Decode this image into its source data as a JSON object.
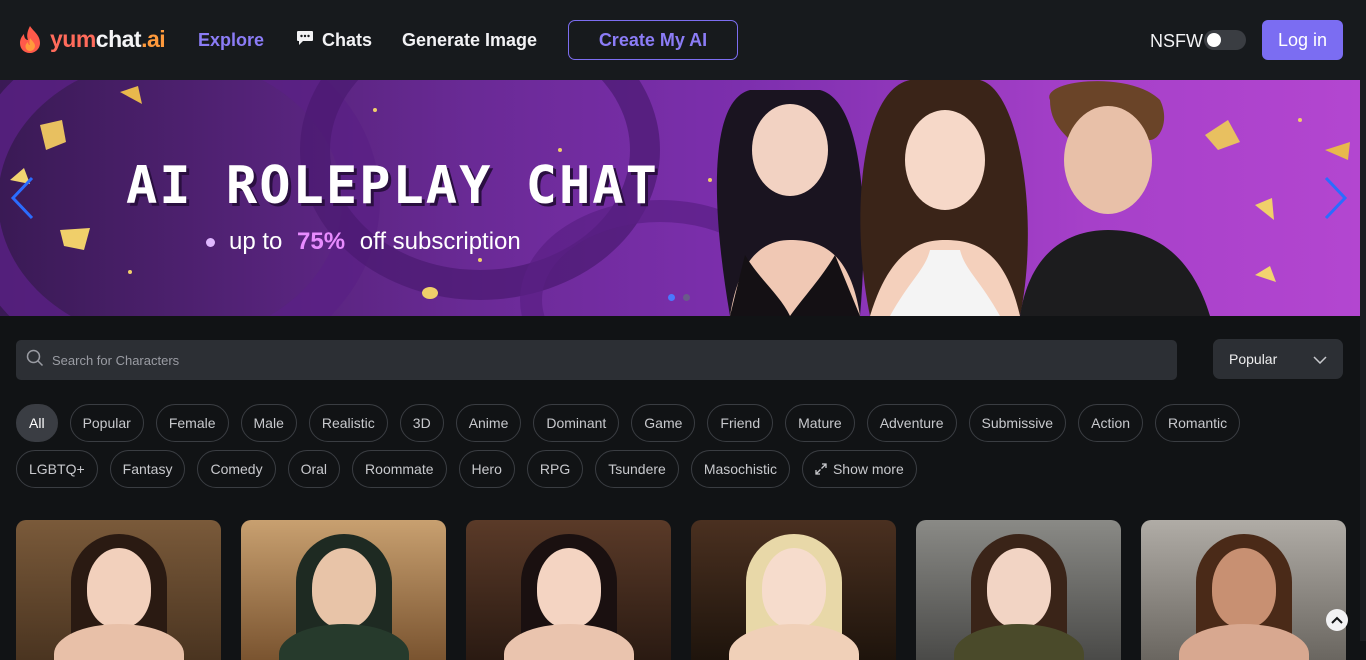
{
  "header": {
    "logo": {
      "part1": "yum",
      "part2": "chat",
      "part3": ".ai"
    },
    "nav": {
      "explore": "Explore",
      "chats": "Chats",
      "generate_image": "Generate Image"
    },
    "create_button": "Create My AI",
    "nsfw_label": "NSFW",
    "nsfw_enabled": false,
    "login_button": "Log in"
  },
  "banner": {
    "title": "AI ROLEPLAY CHAT",
    "subtitle_prefix": "up to ",
    "subtitle_highlight": "75%",
    "subtitle_suffix": " off subscription",
    "slide_count": 2,
    "active_slide": 1
  },
  "search": {
    "placeholder": "Search for Characters"
  },
  "sort": {
    "selected": "Popular"
  },
  "tags": {
    "row1": [
      "All",
      "Popular",
      "Female",
      "Male",
      "Realistic",
      "3D",
      "Anime",
      "Dominant",
      "Game",
      "Friend",
      "Mature",
      "Adventure",
      "Submissive",
      "Action",
      "Romantic"
    ],
    "row2": [
      "LGBTQ+",
      "Fantasy",
      "Comedy",
      "Oral",
      "Roommate",
      "Hero",
      "RPG",
      "Tsundere",
      "Masochistic"
    ],
    "active": "All",
    "show_more": "Show more"
  },
  "colors": {
    "accent": "#7b6df2",
    "page_bg": "#111315",
    "header_bg": "#171a1d"
  }
}
